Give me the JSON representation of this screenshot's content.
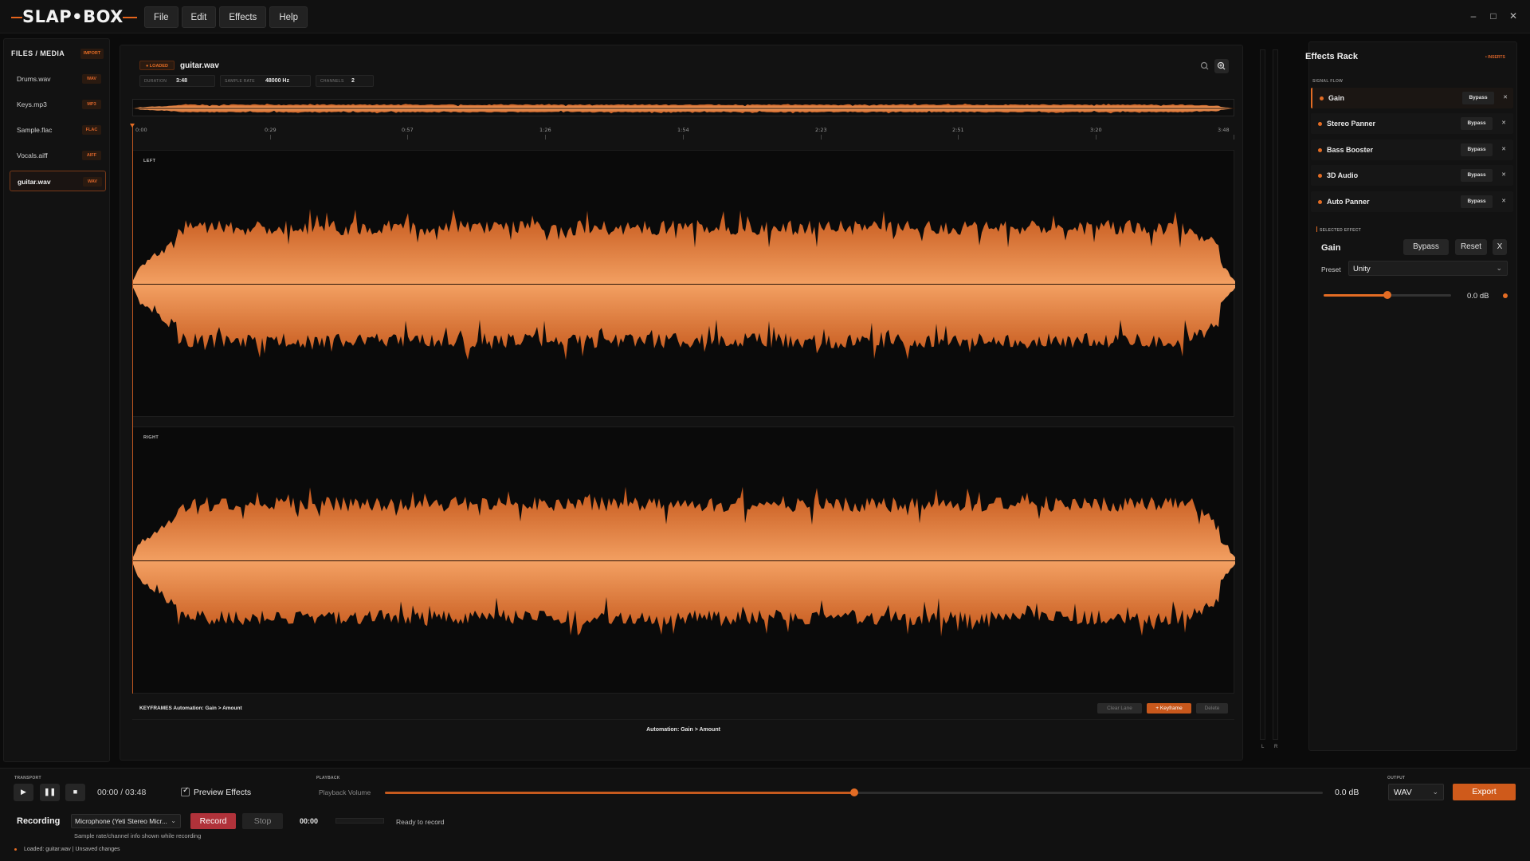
{
  "app": {
    "logo_text": "SLAP•BOX",
    "menu": [
      "File",
      "Edit",
      "Effects",
      "Help"
    ],
    "window_controls": [
      "minimize-icon",
      "maximize-icon",
      "close-icon"
    ]
  },
  "files_panel": {
    "title": "FILES / MEDIA",
    "badge": "IMPORT",
    "items": [
      {
        "name": "Drums.wav",
        "tag": "WAV"
      },
      {
        "name": "Keys.mp3",
        "tag": "MP3"
      },
      {
        "name": "Sample.flac",
        "tag": "FLAC"
      },
      {
        "name": "Vocals.aiff",
        "tag": "AIFF"
      },
      {
        "name": "guitar.wav",
        "tag": "WAV",
        "active": true
      }
    ]
  },
  "editor": {
    "loaded_badge": "● LOADED",
    "filename": "guitar.wav",
    "info": [
      {
        "label": "DURATION",
        "value": "3:48"
      },
      {
        "label": "SAMPLE RATE",
        "value": "48000 Hz"
      },
      {
        "label": "CHANNELS",
        "value": "2"
      }
    ],
    "ruler_ticks": [
      "0:00",
      "0:29",
      "0:57",
      "1:26",
      "1:54",
      "2:23",
      "2:51",
      "3:20",
      "3:48"
    ],
    "channels": [
      "LEFT",
      "RIGHT"
    ],
    "keyframes": {
      "title": "KEYFRAMES  Automation: Gain > Amount",
      "clear_label": "Clear Lane",
      "add_label": "+ Keyframe",
      "delete_label": "Delete",
      "lane_title": "Automation: Gain > Amount"
    },
    "meter_labels": [
      "L",
      "R"
    ]
  },
  "effects_rack": {
    "title": "Effects Rack",
    "inserts_label": "• INSERTS",
    "signal_flow_label": "SIGNAL FLOW",
    "items": [
      {
        "name": "Gain",
        "bypass": "Bypass",
        "remove": "✕",
        "active": true
      },
      {
        "name": "Stereo Panner",
        "bypass": "Bypass",
        "remove": "✕"
      },
      {
        "name": "Bass Booster",
        "bypass": "Bypass",
        "remove": "✕"
      },
      {
        "name": "3D Audio",
        "bypass": "Bypass",
        "remove": "✕"
      },
      {
        "name": "Auto Panner",
        "bypass": "Bypass",
        "remove": "✕"
      }
    ],
    "selected": {
      "section_label": "SELECTED EFFECT",
      "name": "Gain",
      "bypass_label": "Bypass",
      "reset_label": "Reset",
      "close_label": "X",
      "preset_label": "Preset",
      "preset_value": "Unity",
      "gain_value": "0.0 dB",
      "gain_level": 0.5
    }
  },
  "transport": {
    "section_label": "TRANSPORT",
    "time": "00:00 / 03:48",
    "preview_label": "Preview Effects",
    "preview_checked": true,
    "playback_section_label": "PLAYBACK",
    "playback_volume_label": "Playback Volume",
    "playback_volume_value": "0.0 dB",
    "playback_volume_level": 0.5,
    "output_section_label": "OUTPUT",
    "output_format": "WAV",
    "export_label": "Export"
  },
  "recording": {
    "label": "Recording",
    "device": "Microphone (Yeti Stereo Micr...",
    "record_label": "Record",
    "stop_label": "Stop",
    "time": "00:00",
    "status": "Ready to record",
    "hint": "Sample rate/channel info shown while recording"
  },
  "status_bar": {
    "text": "Loaded: guitar.wav  |  Unsaved changes"
  },
  "colors": {
    "accent": "#e36c24",
    "background": "#0b0b0b",
    "panel": "#121212",
    "record": "#b0323a"
  }
}
